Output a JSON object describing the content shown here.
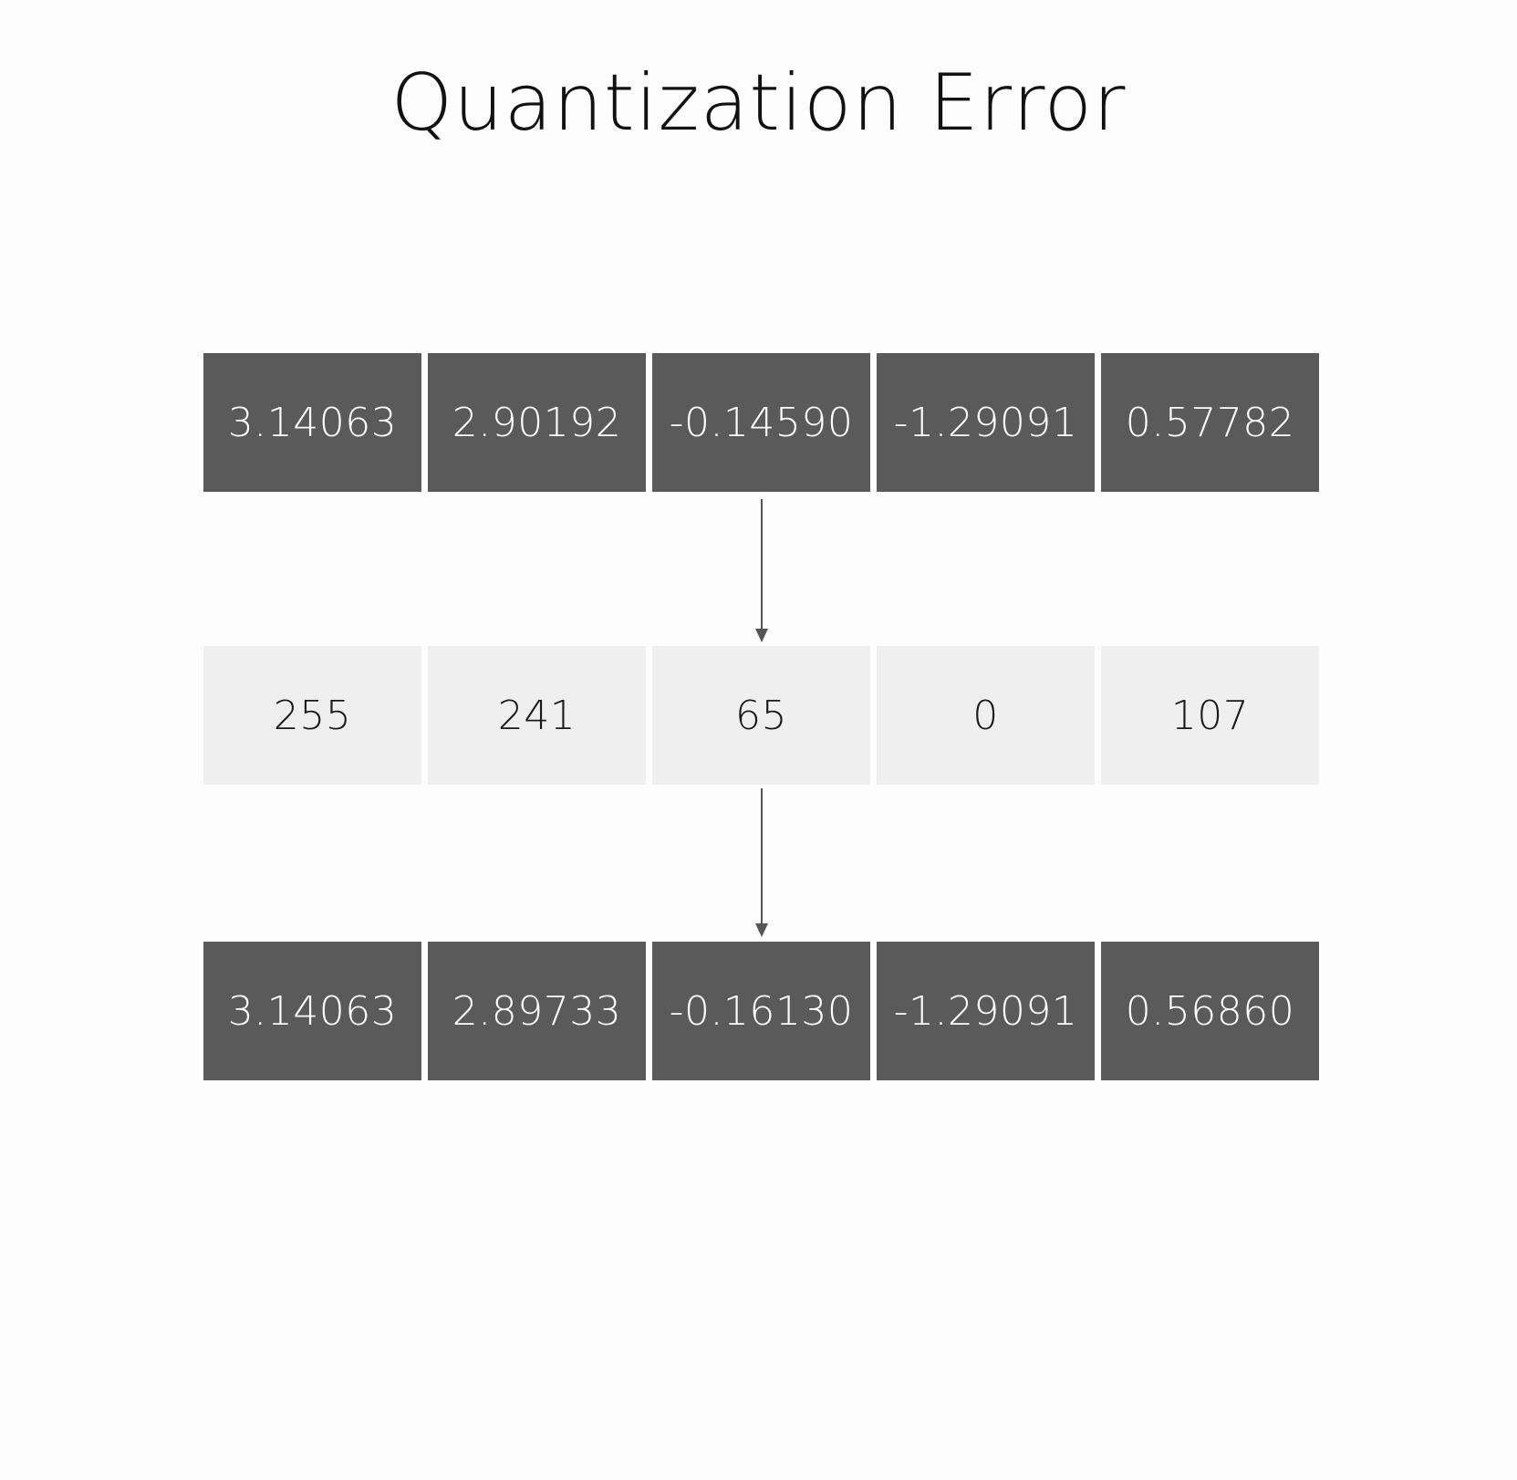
{
  "title": "Quantization Error",
  "rows": {
    "original": [
      "3.14063",
      "2.90192",
      "-0.14590",
      "-1.29091",
      "0.57782"
    ],
    "quantized": [
      "255",
      "241",
      "65",
      "0",
      "107"
    ],
    "dequantized": [
      "3.14063",
      "2.89733",
      "-0.16130",
      "-1.29091",
      "0.56860"
    ]
  },
  "colors": {
    "dark_cell": "#5a5a5a",
    "light_cell": "#efefef",
    "arrow": "#555555"
  }
}
